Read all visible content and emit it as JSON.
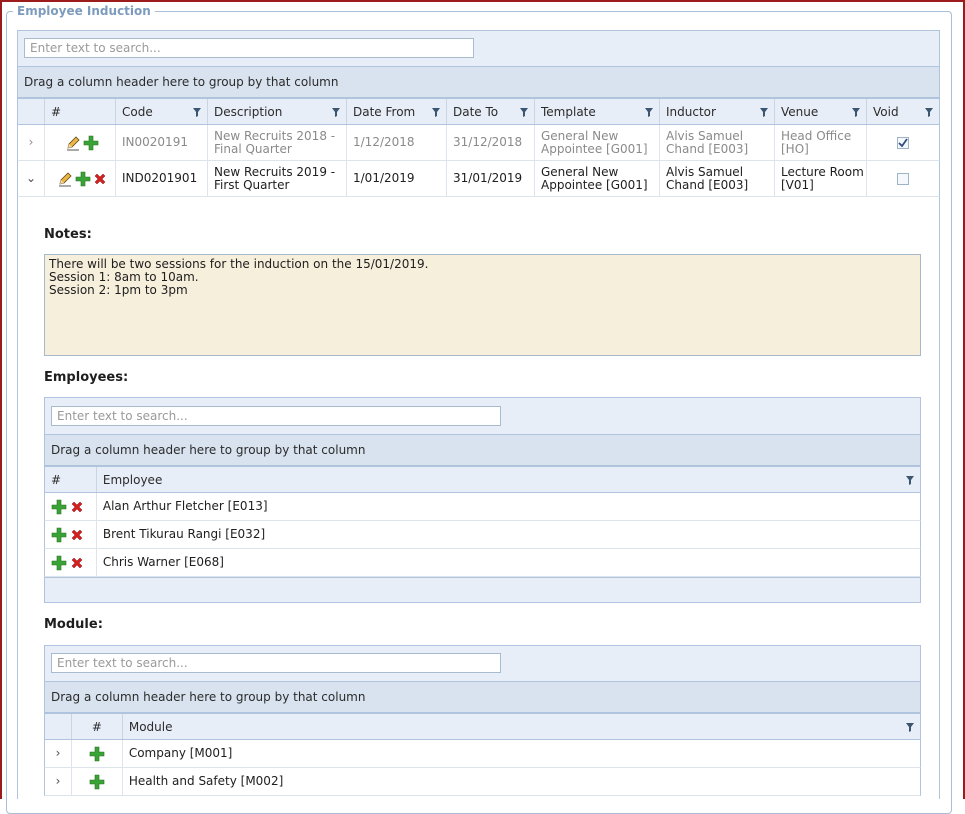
{
  "panel": {
    "legend": "Employee Induction"
  },
  "main": {
    "search_placeholder": "Enter text to search...",
    "group_hint": "Drag a column header here to group by that column",
    "columns": [
      "#",
      "Code",
      "Description",
      "Date From",
      "Date To",
      "Template",
      "Inductor",
      "Venue",
      "Void"
    ],
    "rows": [
      {
        "code": "IN0020191",
        "description": "New Recruits 2018 - Final Quarter",
        "date_from": "1/12/2018",
        "date_to": "31/12/2018",
        "template": "General New Appointee [G001]",
        "inductor": "Alvis Samuel Chand [E003]",
        "venue": "Head Office [HO]",
        "void": true,
        "expand_glyph": "›"
      },
      {
        "code": "IND0201901",
        "description": "New Recruits 2019 - First Quarter",
        "date_from": "1/01/2019",
        "date_to": "31/01/2019",
        "template": "General New Appointee [G001]",
        "inductor": "Alvis Samuel Chand [E003]",
        "venue": "Lecture Room [V01]",
        "void": false,
        "expand_glyph": "⌄"
      }
    ]
  },
  "detail": {
    "notes_label": "Notes:",
    "notes_text": "There will be two sessions for the induction on the 15/01/2019.\nSession 1: 8am to 10am.\nSession 2: 1pm to 3pm",
    "employees": {
      "label": "Employees:",
      "search_placeholder": "Enter text to search...",
      "group_hint": "Drag a column header here to group by that column",
      "columns": [
        "#",
        "Employee"
      ],
      "rows": [
        "Alan Arthur Fletcher [E013]",
        "Brent Tikurau Rangi [E032]",
        "Chris Warner [E068]"
      ]
    },
    "module": {
      "label": "Module:",
      "search_placeholder": "Enter text to search...",
      "group_hint": "Drag a column header here to group by that column",
      "columns": [
        "#",
        "Module"
      ],
      "rows": [
        "Company [M001]",
        "Health and Safety [M002]"
      ],
      "expand_glyph": "›"
    }
  },
  "colors": {
    "accent": "#7d9bbd",
    "header_bg": "#e8eef7",
    "group_bg": "#d8e3ef",
    "notes_bg": "#f6efdc",
    "add_icon": "#3aa335",
    "delete_icon": "#d32020",
    "window_border": "#9c1c1c"
  },
  "icons": [
    "edit-pencil-icon",
    "add-plus-icon",
    "delete-x-icon",
    "filter-funnel-icon",
    "checkbox-checked-icon",
    "expand-chevron-icon"
  ]
}
